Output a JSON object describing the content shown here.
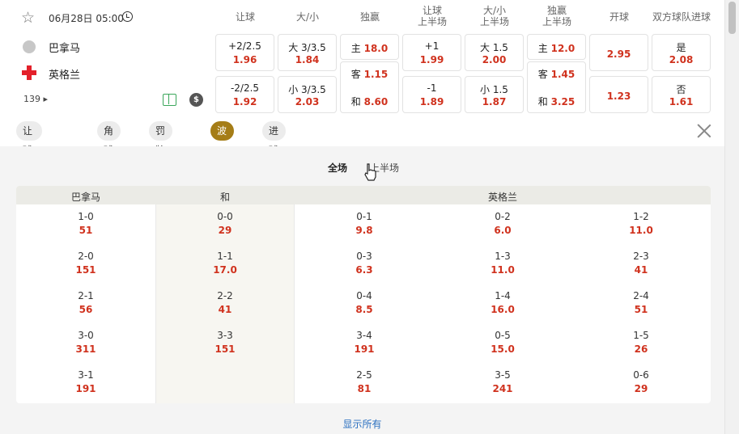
{
  "match": {
    "datetime": "06月28日 05:00",
    "home": "巴拿马",
    "away": "英格兰",
    "more_markets": "139"
  },
  "columns": {
    "handicap": "让球",
    "over_under": "大/小",
    "moneyline": "独赢",
    "handicap_1h_a": "让球",
    "handicap_1h_b": "上半场",
    "ou_1h_a": "大/小",
    "ou_1h_b": "上半场",
    "ml_1h_a": "独赢",
    "ml_1h_b": "上半场",
    "open": "开球",
    "btts": "双方球队进球"
  },
  "odds": {
    "handicap": [
      {
        "label": "+2/2.5",
        "value": "1.96"
      },
      {
        "label": "-2/2.5",
        "value": "1.92"
      }
    ],
    "over_under": [
      {
        "label": "大 3/3.5",
        "value": "1.84"
      },
      {
        "label": "小 3/3.5",
        "value": "2.03"
      }
    ],
    "moneyline": [
      {
        "label": "主",
        "value": "18.0"
      },
      {
        "label": "客",
        "value": "1.15"
      },
      {
        "label": "和",
        "value": "8.60"
      }
    ],
    "handicap_1h": [
      {
        "label": "+1",
        "value": "1.99"
      },
      {
        "label": "-1",
        "value": "1.89"
      }
    ],
    "ou_1h": [
      {
        "label": "大 1.5",
        "value": "2.00"
      },
      {
        "label": "小 1.5",
        "value": "1.87"
      }
    ],
    "ml_1h": [
      {
        "label": "主",
        "value": "12.0"
      },
      {
        "label": "客",
        "value": "1.45"
      },
      {
        "label": "和",
        "value": "3.25"
      }
    ],
    "open": [
      {
        "value": "2.95"
      },
      {
        "value": "1.23"
      }
    ],
    "btts": [
      {
        "label": "是",
        "value": "2.08"
      },
      {
        "label": "否",
        "value": "1.61"
      }
    ]
  },
  "filters": [
    {
      "label": "让球&大/小"
    },
    {
      "label": "角球"
    },
    {
      "label": "罚牌数"
    },
    {
      "label": "波胆"
    },
    {
      "label": "进球球员"
    }
  ],
  "tabs": {
    "full": "全场",
    "half": "上半场"
  },
  "table": {
    "headers": {
      "home": "巴拿马",
      "draw": "和",
      "away": "英格兰"
    },
    "home": [
      {
        "score": "1-0",
        "price": "51"
      },
      {
        "score": "2-0",
        "price": "151"
      },
      {
        "score": "2-1",
        "price": "56"
      },
      {
        "score": "3-0",
        "price": "311"
      },
      {
        "score": "3-1",
        "price": "191"
      }
    ],
    "draw": [
      {
        "score": "0-0",
        "price": "29"
      },
      {
        "score": "1-1",
        "price": "17.0"
      },
      {
        "score": "2-2",
        "price": "41"
      },
      {
        "score": "3-3",
        "price": "151"
      }
    ],
    "away_c1": [
      {
        "score": "0-1",
        "price": "9.8"
      },
      {
        "score": "0-3",
        "price": "6.3"
      },
      {
        "score": "0-4",
        "price": "8.5"
      },
      {
        "score": "3-4",
        "price": "191"
      },
      {
        "score": "2-5",
        "price": "81"
      }
    ],
    "away_c2": [
      {
        "score": "0-2",
        "price": "6.0"
      },
      {
        "score": "1-3",
        "price": "11.0"
      },
      {
        "score": "1-4",
        "price": "16.0"
      },
      {
        "score": "0-5",
        "price": "15.0"
      },
      {
        "score": "3-5",
        "price": "241"
      }
    ],
    "away_c3": [
      {
        "score": "1-2",
        "price": "11.0"
      },
      {
        "score": "2-3",
        "price": "41"
      },
      {
        "score": "2-4",
        "price": "51"
      },
      {
        "score": "1-5",
        "price": "26"
      },
      {
        "score": "0-6",
        "price": "29"
      }
    ]
  },
  "show_all": "显示所有"
}
